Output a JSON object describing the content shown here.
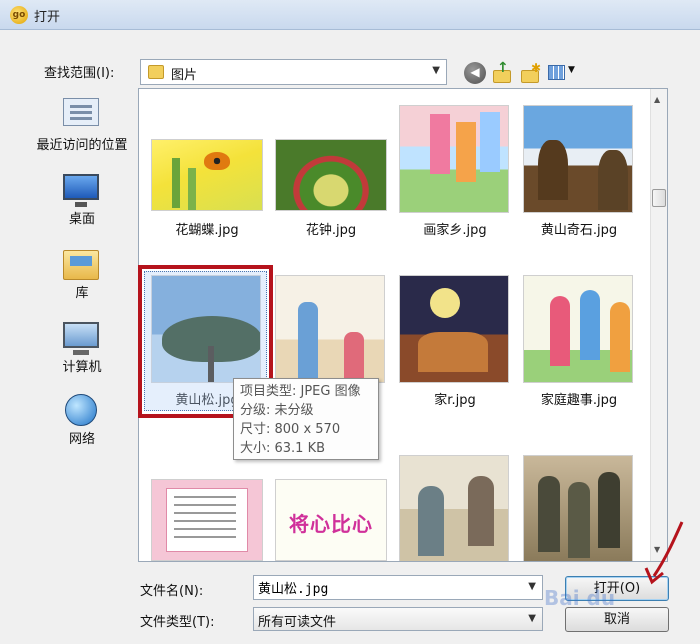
{
  "window": {
    "title": "打开",
    "app_icon_text": "go"
  },
  "lookin": {
    "label": "查找范围(I):",
    "value": "图片"
  },
  "places": [
    {
      "key": "recent",
      "label": "最近访问的位置"
    },
    {
      "key": "desktop",
      "label": "桌面"
    },
    {
      "key": "library",
      "label": "库"
    },
    {
      "key": "computer",
      "label": "计算机"
    },
    {
      "key": "network",
      "label": "网络"
    }
  ],
  "files": [
    {
      "name": "花蝴蝶.jpg"
    },
    {
      "name": "花钟.jpg"
    },
    {
      "name": "画家乡.jpg"
    },
    {
      "name": "黄山奇石.jpg"
    },
    {
      "name": "黄山松.jpg"
    },
    {
      "name": ""
    },
    {
      "name": "家r.jpg"
    },
    {
      "name": "家庭趣事.jpg"
    },
    {
      "name": ""
    },
    {
      "name": "将心比心"
    },
    {
      "name": ""
    },
    {
      "name": ""
    }
  ],
  "tooltip": {
    "line1": "项目类型: JPEG 图像",
    "line2": "分级: 未分级",
    "line3": "尺寸: 800 x 570",
    "line4": "大小: 63.1 KB"
  },
  "filename": {
    "label": "文件名(N):",
    "value": "黄山松.jpg"
  },
  "filetype": {
    "label": "文件类型(T):",
    "value": "所有可读文件"
  },
  "buttons": {
    "open": "打开(O)",
    "cancel": "取消"
  },
  "watermark": "Bai du",
  "colors": {
    "selection": "#b5131c",
    "titlebar": "#dfe9f5"
  }
}
